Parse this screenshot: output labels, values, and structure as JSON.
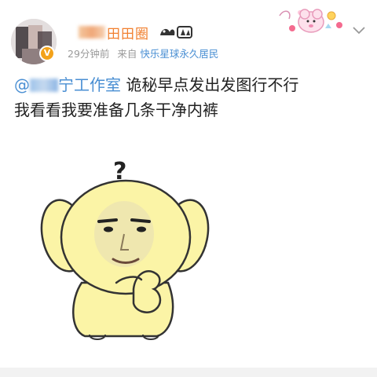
{
  "post": {
    "username": "田田圈",
    "timestamp": "29分钟前",
    "source_label": "来自",
    "source_name": "快乐星球永久居民",
    "verified_badge": "V",
    "mention_suffix": "宁工作室",
    "body_line1_tail": "诡秘早点发出发图行不行",
    "body_line2": "我看看我要准备几条干净内裤"
  },
  "meme": {
    "question_mark": "?"
  },
  "colors": {
    "username": "#f17f2e",
    "link": "#4a8fd3",
    "meta": "#9a9a9a",
    "text": "#222222",
    "badge": "#f3a21a",
    "meme_body": "#fbf4a6"
  },
  "icons": {
    "chevron": "chevron-down-icon",
    "member_badge": "member-badge-icon",
    "sticker": "pink-sticker-icon"
  }
}
